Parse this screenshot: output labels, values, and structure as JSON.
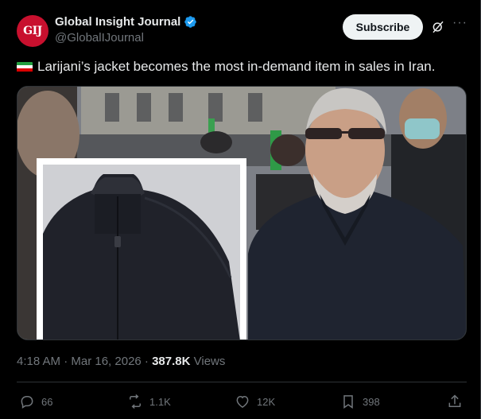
{
  "account": {
    "avatar_text": "GIJ",
    "display_name": "Global Insight Journal",
    "handle": "@GlobalIJournal",
    "verified_icon": "verified-badge-icon",
    "brand_color": "#c8102e"
  },
  "header": {
    "subscribe_label": "Subscribe",
    "grok_icon": "grok-icon",
    "more_icon": "more-icon"
  },
  "tweet": {
    "text": "Larijani’s jacket becomes the most in-demand item in sales in Iran.",
    "flag": "iran-flag-icon",
    "timestamp": "4:18 AM · Mar 16, 2026 · ",
    "views_count": "387.8K",
    "views_label": " Views"
  },
  "actions": {
    "replies": "66",
    "reposts": "1.1K",
    "likes": "12K",
    "bookmarks": "398"
  },
  "colors": {
    "background": "#000000",
    "text_primary": "#e7e9ea",
    "text_secondary": "#71767b",
    "border": "#2f3336",
    "verified": "#1d9bf0"
  }
}
